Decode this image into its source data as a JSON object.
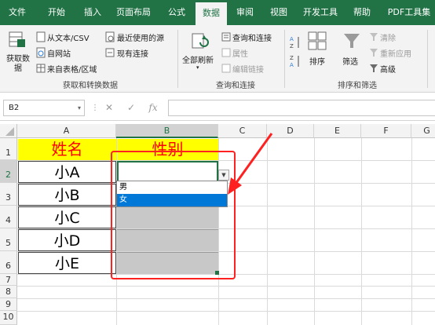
{
  "tabs": [
    "文件",
    "开始",
    "插入",
    "页面布局",
    "公式",
    "数据",
    "审阅",
    "视图",
    "开发工具",
    "帮助",
    "PDF工具集"
  ],
  "active_tab": "数据",
  "ribbon": {
    "get_data": {
      "big_button": "获取数\n据",
      "items": [
        "从文本/CSV",
        "自网站",
        "来自表格/区域",
        "最近使用的源",
        "现有连接"
      ],
      "group_label": "获取和转换数据"
    },
    "queries": {
      "big_button": "全部刷新",
      "items": [
        "查询和连接",
        "属性",
        "编辑链接"
      ],
      "group_label": "查询和连接"
    },
    "sort_filter": {
      "sort_button": "排序",
      "filter_button": "筛选",
      "items": [
        "清除",
        "重新应用",
        "高级"
      ],
      "group_label": "排序和筛选"
    }
  },
  "formula_bar": {
    "name_box": "B2",
    "cancel": "✕",
    "enter": "✓",
    "fx": "fx",
    "value": ""
  },
  "columns": [
    "A",
    "B",
    "C",
    "D",
    "E",
    "F",
    "G"
  ],
  "rows": [
    "1",
    "2",
    "3",
    "4",
    "5",
    "6",
    "7",
    "8",
    "9",
    "10"
  ],
  "cells": {
    "A1": "姓名",
    "B1": "性别",
    "A2": "小A",
    "A3": "小B",
    "A4": "小C",
    "A5": "小D",
    "A6": "小E"
  },
  "dropdown": {
    "options": [
      "男",
      "女"
    ],
    "highlighted": "女"
  },
  "colors": {
    "excel_green": "#217346",
    "header_fill": "#ffff00",
    "header_text": "#ff0000",
    "annotation_red": "#ff2020",
    "highlight_blue": "#0078d7"
  }
}
